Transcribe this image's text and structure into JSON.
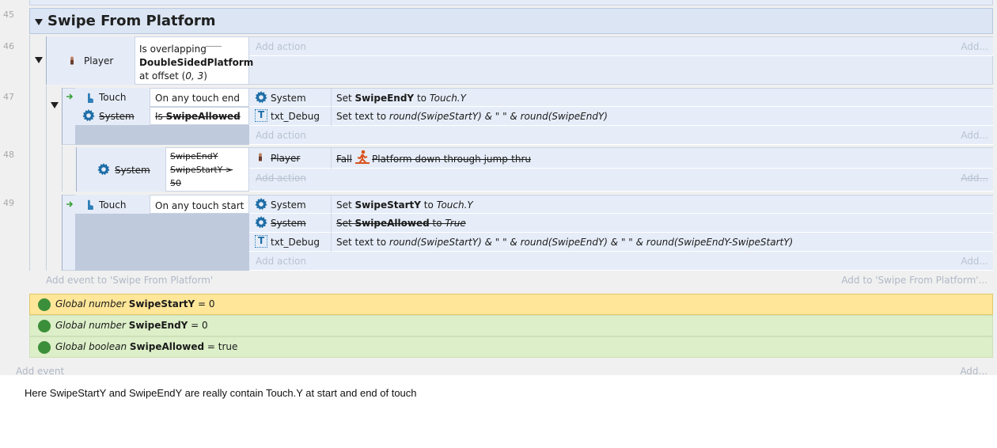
{
  "group": {
    "line_number": "45",
    "title": "Swipe From Platform",
    "add_event_label": "Add event to 'Swipe From Platform'",
    "add_to_label": "Add to 'Swipe From Platform'..."
  },
  "events": [
    {
      "line_number": "46",
      "conditions": [
        {
          "object": "Player",
          "text_line1": "Is overlapping",
          "text_line2": "DoubleSidedPlatform",
          "text_line3a": "at offset (",
          "text_line3b": "0, 3",
          "text_line3c": ")"
        }
      ],
      "actions": [],
      "add_action": "Add action",
      "add_more": "Add..."
    },
    {
      "line_number": "47",
      "conditions": [
        {
          "object": "Touch",
          "text": "On any touch end"
        },
        {
          "object": "System",
          "text_prefix": "Is ",
          "text_bold": "SwipeAllowed",
          "disabled": true
        }
      ],
      "actions": [
        {
          "object": "System",
          "prefix": "Set ",
          "var": "SwipeEndY",
          "mid": " to ",
          "value": "Touch.Y"
        },
        {
          "object": "txt_Debug",
          "prefix": "Set text to ",
          "value": "round(SwipeStartY) & \" \" & round(SwipeEndY)"
        }
      ],
      "add_action": "Add action",
      "add_more": "Add..."
    },
    {
      "line_number": "48",
      "conditions": [
        {
          "object": "System",
          "line1": "SwipeEndY",
          "line2": "SwipeStartY >",
          "line3": "50",
          "disabled": true
        }
      ],
      "actions": [
        {
          "object": "Player",
          "prefix": "Fall",
          "text": "Platform down through jump-thru",
          "disabled": true
        }
      ],
      "add_action": "Add action",
      "add_more": "Add..."
    },
    {
      "line_number": "49",
      "conditions": [
        {
          "object": "Touch",
          "text": "On any touch start"
        }
      ],
      "actions": [
        {
          "object": "System",
          "prefix": "Set ",
          "var": "SwipeStartY",
          "mid": " to ",
          "value": "Touch.Y"
        },
        {
          "object": "System",
          "prefix": "Set ",
          "var": "SwipeAllowed",
          "mid": " to ",
          "value": "True",
          "disabled": true
        },
        {
          "object": "txt_Debug",
          "prefix": "Set text to ",
          "value": "round(SwipeStartY) & \" \" & round(SwipeEndY) & \" \" & round(SwipeEndY-SwipeStartY)"
        }
      ],
      "add_action": "Add action",
      "add_more": "Add..."
    }
  ],
  "globals": [
    {
      "type": "Global number",
      "name": "SwipeStartY",
      "rest": " = 0",
      "selected": true
    },
    {
      "type": "Global number",
      "name": "SwipeEndY",
      "rest": " = 0"
    },
    {
      "type": "Global boolean",
      "name": "SwipeAllowed",
      "rest": " = true"
    }
  ],
  "bottom": {
    "add_event": "Add event",
    "add_more": "Add..."
  },
  "note": "Here SwipeStartY and SwipeEndY are really contain Touch.Y at start and end of touch",
  "colors": {
    "selected_row": "#ffe699",
    "global_row": "#dcefc8",
    "block": "#e6ecf7",
    "accent_arrow": "#3aa03a"
  }
}
